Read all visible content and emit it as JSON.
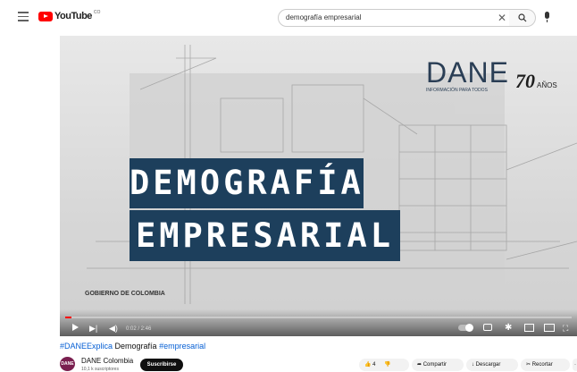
{
  "header": {
    "logo_text": "YouTube",
    "logo_sup": "CO",
    "search_value": "demografía empresarial",
    "clear_glyph": "✕",
    "search_glyph": "⚲"
  },
  "video": {
    "title_line1": "DEMOGRAFÍA",
    "title_line2": "EMPRESARIAL",
    "gov_text": "GOBIERNO DE COLOMBIA",
    "brand_word": "DANE",
    "brand_sub": "INFORMACIÓN PARA TODOS",
    "brand_years": "70",
    "brand_years_word": "AÑOS",
    "time": "0:02 / 2:46",
    "progress_fraction": 0.012
  },
  "player_icons": {
    "next": "▶|",
    "volume": "◀)",
    "gear": "✱",
    "fullscreen": "⛶"
  },
  "info": {
    "hashtag1": "#DANEExplica",
    "title_text": " Demografía ",
    "hashtag2": "#empresarial",
    "channel_name": "DANE Colombia",
    "avatar_text": "DANE",
    "subscribers": "10,1 k suscriptores",
    "subscribe_label": "Suscribirse",
    "like_count": "4",
    "share_label": "Compartir",
    "download_label": "Descargar",
    "clip_label": "Recortar",
    "more_label": "·"
  },
  "colors": {
    "title_band": "#1d3f5c",
    "brand": "#2a3e55",
    "progress": "#ff0000",
    "hashtag": "#065fd4"
  }
}
